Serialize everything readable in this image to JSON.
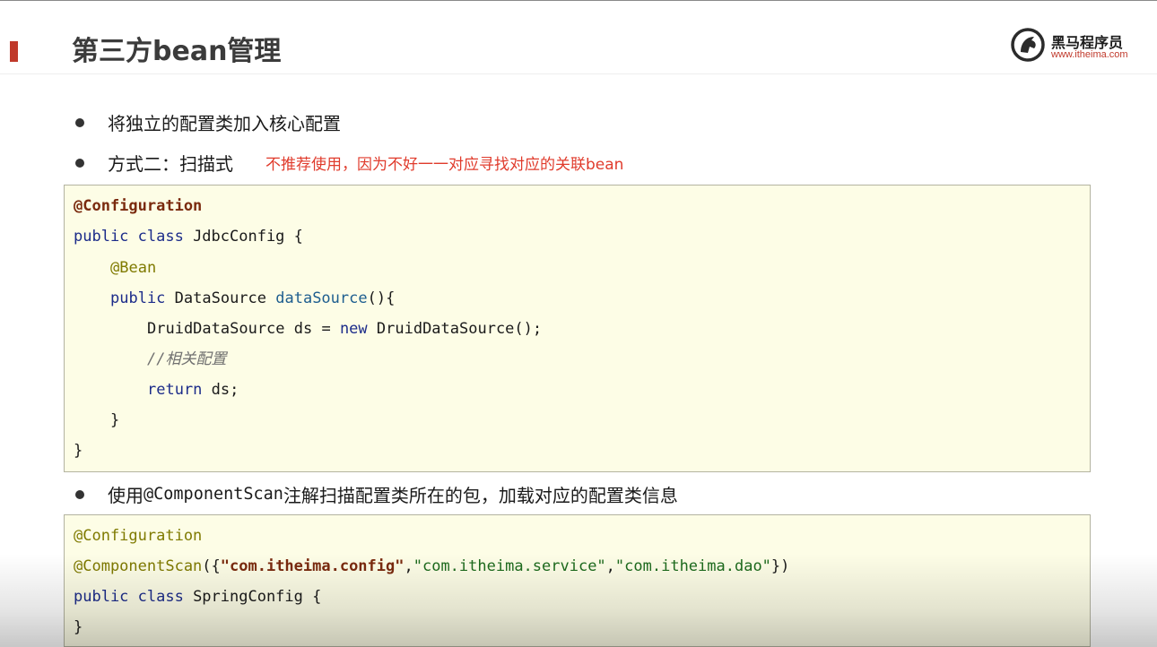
{
  "slide": {
    "title": "第三方bean管理",
    "logo": {
      "name_cn": "黑马程序员",
      "url": "www.itheima.com"
    }
  },
  "bullets": [
    {
      "text": "将独立的配置类加入核心配置"
    },
    {
      "text": "方式二：扫描式",
      "note": "不推荐使用，因为不好一一对应寻找对应的关联bean"
    },
    {
      "text_prefix": "使用",
      "text_code": "@ComponentScan",
      "text_suffix": "注解扫描配置类所在的包，加载对应的配置类信息"
    }
  ],
  "code_block_1": {
    "l1": "@Configuration",
    "l2_kw": "public class",
    "l2_rest": " JdbcConfig {",
    "l3": "@Bean",
    "l4_kw": "public",
    "l4_type": " DataSource ",
    "l4_method": "dataSource",
    "l4_rest": "(){",
    "l5_a": "DruidDataSource ds = ",
    "l5_kw": "new",
    "l5_b": " DruidDataSource();",
    "l6": "//相关配置",
    "l7_kw": "return",
    "l7_rest": " ds;",
    "l8": "}",
    "l9": "}"
  },
  "code_block_2": {
    "l1": "@Configuration",
    "l2_ann": "@ComponentScan",
    "l2_open": "({",
    "l2_s1": "\"com.itheima.config\"",
    "l2_c1": ",",
    "l2_s2": "\"com.itheima.service\"",
    "l2_c2": ",",
    "l2_s3": "\"com.itheima.dao\"",
    "l2_close": "})",
    "l3_kw": "public class",
    "l3_rest": " SpringConfig {",
    "l4": "}"
  },
  "colors": {
    "accent": "#c0392b",
    "note": "#e03b2c",
    "code_bg": "#fdfde6"
  }
}
